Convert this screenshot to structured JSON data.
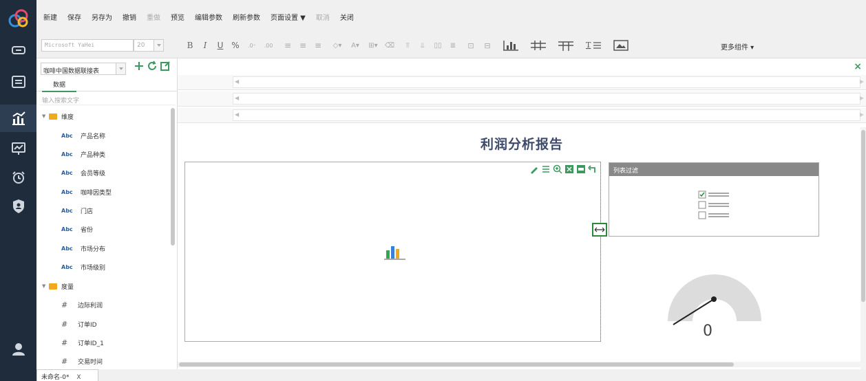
{
  "menu": {
    "items": [
      "新建",
      "保存",
      "另存为",
      "撤销",
      "重做",
      "预览",
      "编辑参数",
      "刷新参数",
      "页面设置 ▼",
      "取消",
      "关闭"
    ],
    "disabled": [
      false,
      false,
      false,
      false,
      true,
      false,
      false,
      false,
      false,
      true,
      false
    ]
  },
  "toolbar": {
    "font": "Microsoft YaHei",
    "size": "20",
    "bold": "B",
    "italic": "I",
    "underline": "U",
    "percent": "%",
    "more_components": "更多组件 ▾"
  },
  "left_panel": {
    "dataset": "咖啡中国数据联接表",
    "tab": "数据",
    "search_placeholder": "输入搜索文字",
    "dimension_group": "维度",
    "dimensions": [
      "产品名称",
      "产品种类",
      "会员等级",
      "咖啡因类型",
      "门店",
      "省份",
      "市场分布",
      "市场级别"
    ],
    "measure_group": "度量",
    "measures": [
      "边际利润",
      "订单ID",
      "订单ID_1",
      "交易时间"
    ],
    "abc_label": "Abc",
    "hash_label": "#"
  },
  "canvas": {
    "close": "×",
    "report_title": "利润分析报告",
    "filter_title": "列表过滤",
    "gauge_value": "0"
  },
  "document_tab": {
    "name": "未命名-0*",
    "close": "X"
  },
  "colors": {
    "rail": "#1f2c3c",
    "accent_green": "#3c9a5f",
    "title_blue": "#3d4a6b",
    "folder": "#f0a81c"
  }
}
